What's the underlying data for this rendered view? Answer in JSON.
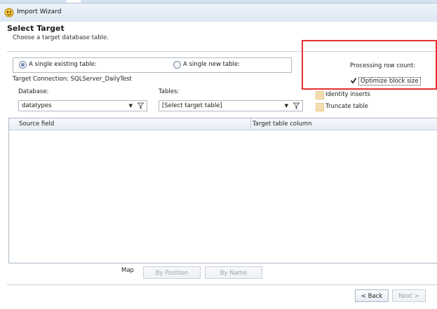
{
  "window": {
    "title": "Import Wizard"
  },
  "header": {
    "title": "Select Target",
    "subtitle": "Choose a target database table."
  },
  "target_mode": {
    "existing_label": "A single existing table:",
    "new_label": "A single new table:",
    "selected": "existing"
  },
  "connection": {
    "label": "Target Connection: SQLServer_DailyTest"
  },
  "database": {
    "label": "Database:",
    "value": "datatypes"
  },
  "tables": {
    "label": "Tables:",
    "value": "[Select target table]"
  },
  "options": {
    "processing_row_count_label": "Processing row count:",
    "optimize_block_size_label": "Optimize block size",
    "optimize_block_size_checked": true,
    "identity_inserts_label": "Identity inserts",
    "truncate_table_label": "Truncate table"
  },
  "mapping_grid": {
    "columns": [
      "Source field",
      "Target table column"
    ]
  },
  "map": {
    "label": "Map",
    "by_position_label": "By Position",
    "by_name_label": "By Name"
  },
  "footer": {
    "back_label": "< Back",
    "next_label": "Next >"
  },
  "colors": {
    "highlight_frame": "#e5302e",
    "accent": "#6f8db5"
  }
}
